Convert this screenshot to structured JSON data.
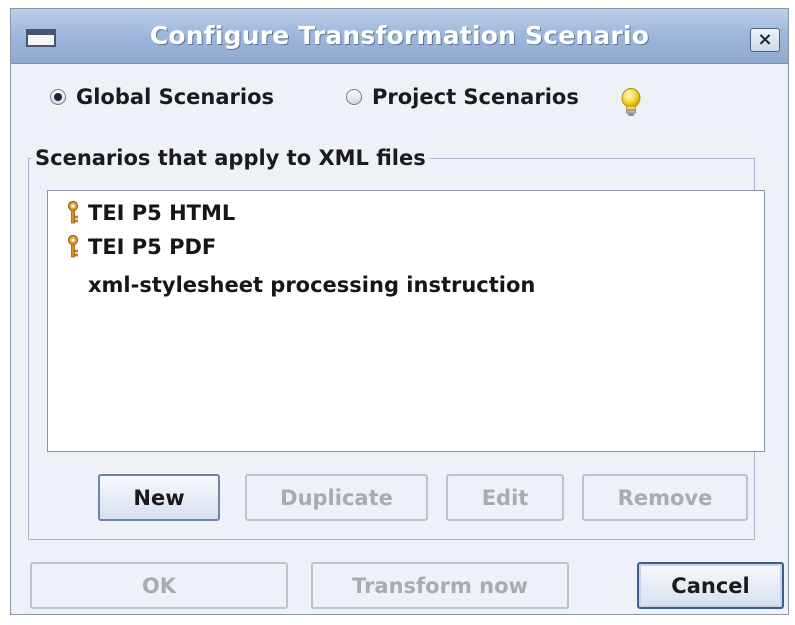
{
  "window": {
    "title": "Configure Transformation Scenario",
    "close_glyph": "×"
  },
  "scope": {
    "options": [
      {
        "label": "Global Scenarios",
        "checked": true
      },
      {
        "label": "Project Scenarios",
        "checked": false
      }
    ],
    "hint_icon": "lightbulb-icon"
  },
  "group": {
    "legend": "Scenarios that apply to XML files"
  },
  "scenarios": [
    {
      "label": "TEI P5 HTML",
      "icon": "key-icon"
    },
    {
      "label": "TEI P5 PDF",
      "icon": "key-icon"
    },
    {
      "label": "xml-stylesheet processing instruction",
      "icon": ""
    }
  ],
  "list_buttons": {
    "new": "New",
    "duplicate": "Duplicate",
    "edit": "Edit",
    "remove": "Remove"
  },
  "dialog_buttons": {
    "ok": "OK",
    "transform_now": "Transform now",
    "cancel": "Cancel"
  },
  "colors": {
    "titlebar": "#9fb8db",
    "dialog_bg": "#eef1f7",
    "key_icon": "#c9820f"
  }
}
